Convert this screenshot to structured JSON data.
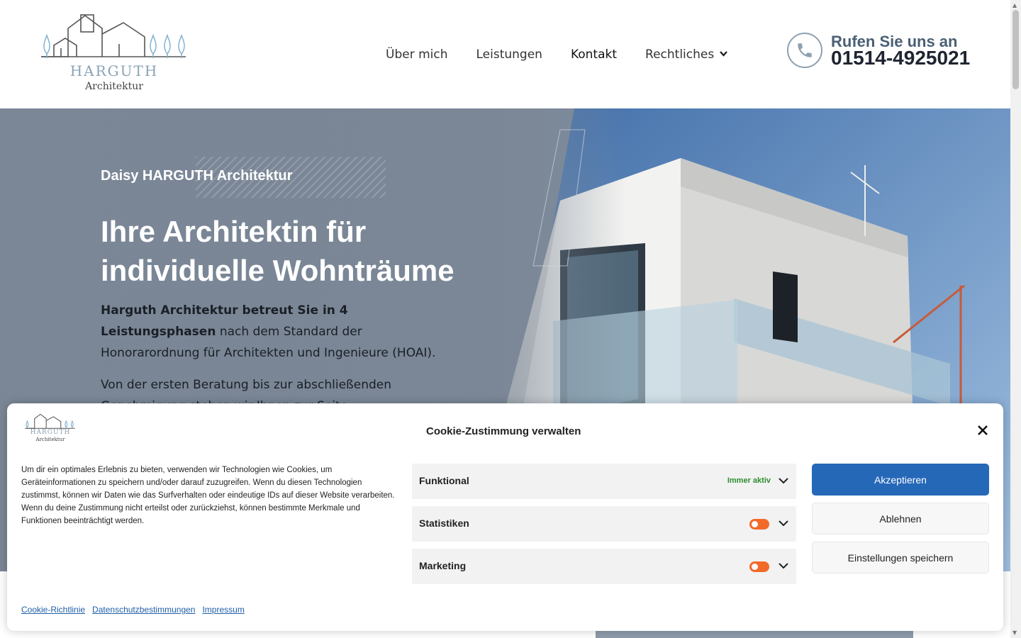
{
  "header": {
    "logo": {
      "name": "HARGUTH",
      "sub": "Architektur"
    },
    "nav": [
      {
        "label": "Über mich"
      },
      {
        "label": "Leistungen"
      },
      {
        "label": "Kontakt"
      },
      {
        "label": "Rechtliches"
      }
    ],
    "phone": {
      "label": "Rufen Sie uns an",
      "number": "01514-4925021",
      "icon": "phone-icon"
    }
  },
  "hero": {
    "eyebrow": "Daisy HARGUTH Architektur",
    "title": "Ihre Architektin für individuelle Wohnträume",
    "intro_bold": "Harguth Architektur betreut Sie in 4 Leistungsphasen",
    "intro_rest": " nach dem Standard der Honorarordnung für Architekten und Ingenieure (HOAI).",
    "paragraph2": "Von der ersten Beratung bis zur abschließenden Genehmigung stehen wir Ihnen zur Seite."
  },
  "cookie": {
    "logo": {
      "name": "HARGUTH",
      "sub": "Architektur"
    },
    "title": "Cookie-Zustimmung verwalten",
    "text": "Um dir ein optimales Erlebnis zu bieten, verwenden wir Technologien wie Cookies, um Geräteinformationen zu speichern und/oder darauf zuzugreifen. Wenn du diesen Technologien zustimmst, können wir Daten wie das Surfverhalten oder eindeutige IDs auf dieser Website verarbeiten. Wenn du deine Zustimmung nicht erteilst oder zurückziehst, können bestimmte Merkmale und Funktionen beeinträchtigt werden.",
    "categories": [
      {
        "label": "Funktional",
        "status": "Immer aktiv"
      },
      {
        "label": "Statistiken"
      },
      {
        "label": "Marketing"
      }
    ],
    "buttons": {
      "accept": "Akzeptieren",
      "deny": "Ablehnen",
      "save": "Einstellungen speichern"
    },
    "links": [
      "Cookie-Richtlinie",
      "Datenschutzbestimmungen",
      "Impressum"
    ],
    "colors": {
      "accept": "#2568b8",
      "toggle": "#f26a2a",
      "always_active": "#2e8c2e",
      "link": "#1f5fa8"
    }
  }
}
